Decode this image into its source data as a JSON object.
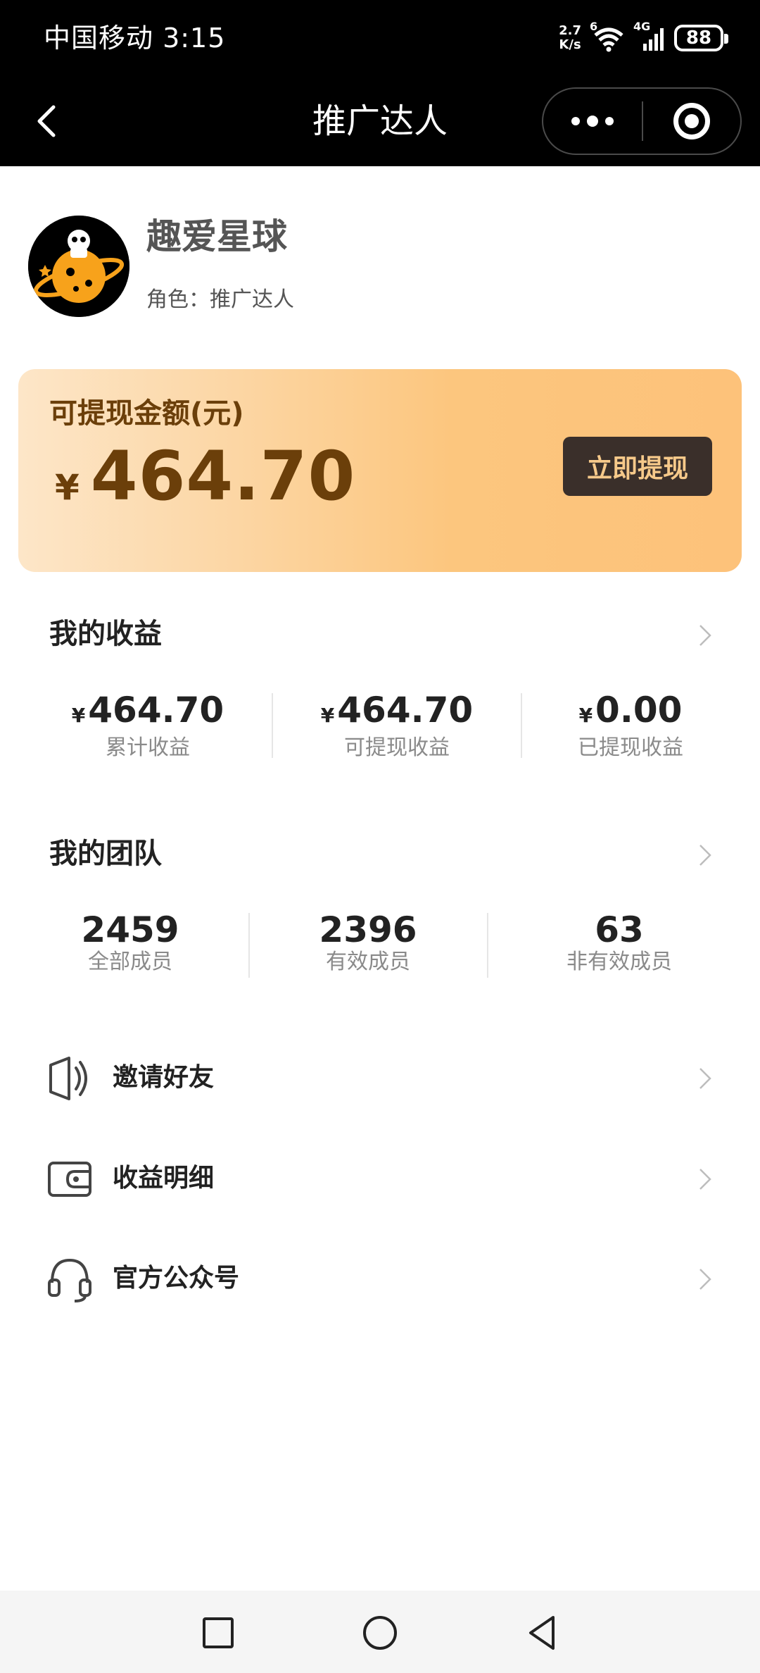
{
  "status_bar": {
    "carrier_time": "中国移动 3:15",
    "net_speed_top": "2.7",
    "net_speed_bottom": "K/s",
    "wifi_tag": "6",
    "signal_tag": "4G",
    "battery": "88"
  },
  "nav": {
    "title": "推广达人"
  },
  "profile": {
    "name": "趣爱星球",
    "role": "角色：推广达人"
  },
  "balance": {
    "label": "可提现金额(元)",
    "currency": "¥",
    "amount": "464.70",
    "withdraw_label": "立即提现"
  },
  "earnings": {
    "title": "我的收益",
    "items": [
      {
        "currency": "¥",
        "value": "464.70",
        "label": "累计收益"
      },
      {
        "currency": "¥",
        "value": "464.70",
        "label": "可提现收益"
      },
      {
        "currency": "¥",
        "value": "0.00",
        "label": "已提现收益"
      }
    ]
  },
  "team": {
    "title": "我的团队",
    "items": [
      {
        "value": "2459",
        "label": "全部成员"
      },
      {
        "value": "2396",
        "label": "有效成员"
      },
      {
        "value": "63",
        "label": "非有效成员"
      }
    ]
  },
  "menu": [
    {
      "label": "邀请好友",
      "icon": "megaphone-icon"
    },
    {
      "label": "收益明细",
      "icon": "wallet-icon"
    },
    {
      "label": "官方公众号",
      "icon": "headset-icon"
    }
  ],
  "colors": {
    "card_text": "#6b3f0a",
    "button_bg": "#3a2f2a",
    "button_text": "#f6c98a",
    "planet": "#f7a21b"
  }
}
